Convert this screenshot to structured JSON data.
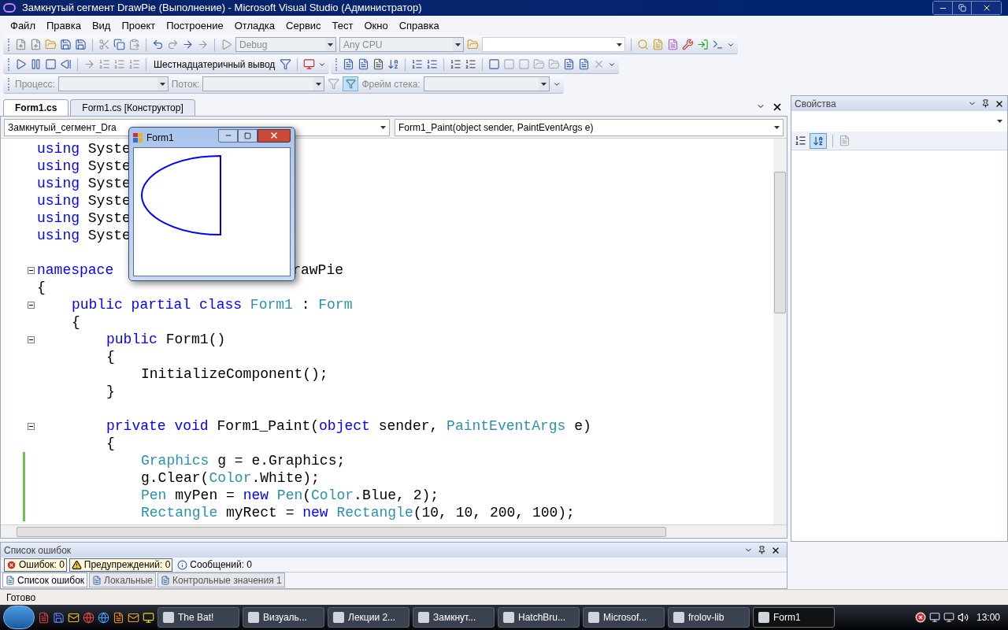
{
  "window": {
    "title": "Замкнутый сегмент DrawPie (Выполнение) - Microsoft Visual Studio (Администратор)"
  },
  "menu": [
    "Файл",
    "Правка",
    "Вид",
    "Проект",
    "Построение",
    "Отладка",
    "Сервис",
    "Тест",
    "Окно",
    "Справка"
  ],
  "toolbar": {
    "configuration": "Debug",
    "platform": "Any CPU",
    "hex_button": "Шестнадцатеричный вывод",
    "process_label": "Процесс:",
    "thread_label": "Поток:",
    "stack_frame_label": "Фрейм стека:"
  },
  "doc_tabs": [
    {
      "label": "Form1.cs",
      "selected": true
    },
    {
      "label": "Form1.cs [Конструктор]",
      "selected": false
    }
  ],
  "editor": {
    "type_dropdown": "Замкнутый_сегмент_Dra",
    "member_dropdown": "Form1_Paint(object sender, PaintEventArgs e)",
    "lines": [
      {
        "fold": false,
        "changed": false,
        "tokens": [
          {
            "text": "using ",
            "kind": "kw"
          },
          {
            "text": "Syste",
            "kind": "plain"
          }
        ]
      },
      {
        "fold": false,
        "changed": false,
        "tokens": [
          {
            "text": "using ",
            "kind": "kw"
          },
          {
            "text": "Syste",
            "kind": "plain"
          }
        ]
      },
      {
        "fold": false,
        "changed": false,
        "tokens": [
          {
            "text": "using ",
            "kind": "kw"
          },
          {
            "text": "Syste",
            "kind": "plain"
          }
        ]
      },
      {
        "fold": false,
        "changed": false,
        "tokens": [
          {
            "text": "using ",
            "kind": "kw"
          },
          {
            "text": "Syste",
            "kind": "plain"
          }
        ]
      },
      {
        "fold": false,
        "changed": false,
        "tokens": [
          {
            "text": "using ",
            "kind": "kw"
          },
          {
            "text": "Syste",
            "kind": "plain"
          }
        ]
      },
      {
        "fold": false,
        "changed": false,
        "tokens": [
          {
            "text": "using ",
            "kind": "kw"
          },
          {
            "text": "Syste",
            "kind": "plain"
          }
        ]
      },
      {
        "fold": false,
        "changed": false
      },
      {
        "fold": true,
        "changed": false,
        "tokens": [
          {
            "text": "namespace",
            "kind": "kw"
          },
          {
            "text": "rawPie",
            "kind": "plain",
            "after_gap": true
          }
        ]
      },
      {
        "fold": false,
        "changed": false,
        "tokens": [
          {
            "text": "{",
            "kind": "plain"
          }
        ],
        "children": [
          {
            "fold": true,
            "changed": false,
            "tokens": [
              {
                "text": "public partial class ",
                "kind": "kw"
              },
              {
                "text": "Form1",
                "kind": "type"
              },
              {
                "text": " : ",
                "kind": "plain"
              },
              {
                "text": "Form",
                "kind": "type"
              }
            ]
          },
          {
            "fold": false,
            "changed": false,
            "tokens": [
              {
                "text": "{",
                "kind": "plain"
              }
            ],
            "children": [
              {
                "fold": true,
                "changed": false,
                "tokens": [
                  {
                    "text": "public ",
                    "kind": "kw"
                  },
                  {
                    "text": "Form1()",
                    "kind": "plain"
                  }
                ]
              },
              {
                "fold": false,
                "changed": false,
                "tokens": [
                  {
                    "text": "{",
                    "kind": "plain"
                  }
                ],
                "children": [
                  {
                    "fold": false,
                    "changed": false,
                    "tokens": [
                      {
                        "text": "InitializeComponent();",
                        "kind": "plain"
                      }
                    ]
                  }
                ]
              },
              {
                "fold": false,
                "changed": false,
                "tokens": [
                  {
                    "text": "}",
                    "kind": "plain"
                  }
                ]
              },
              {
                "fold": false,
                "changed": false
              },
              {
                "fold": true,
                "changed": false,
                "tokens": [
                  {
                    "text": "private void ",
                    "kind": "kw"
                  },
                  {
                    "text": "Form1_Paint(",
                    "kind": "plain"
                  },
                  {
                    "text": "object ",
                    "kind": "kw"
                  },
                  {
                    "text": "sender, ",
                    "kind": "plain"
                  },
                  {
                    "text": "PaintEventArgs",
                    "kind": "type"
                  },
                  {
                    "text": " e)",
                    "kind": "plain"
                  }
                ]
              },
              {
                "fold": false,
                "changed": false,
                "tokens": [
                  {
                    "text": "{",
                    "kind": "plain"
                  }
                ],
                "children": [
                  {
                    "fold": false,
                    "changed": true,
                    "tokens": [
                      {
                        "text": "Graphics",
                        "kind": "type"
                      },
                      {
                        "text": " g = e.Graphics;",
                        "kind": "plain"
                      }
                    ]
                  },
                  {
                    "fold": false,
                    "changed": true,
                    "tokens": [
                      {
                        "text": "g.Clear(",
                        "kind": "plain"
                      },
                      {
                        "text": "Color",
                        "kind": "type"
                      },
                      {
                        "text": ".White);",
                        "kind": "plain"
                      }
                    ]
                  },
                  {
                    "fold": false,
                    "changed": true,
                    "tokens": [
                      {
                        "text": "Pen",
                        "kind": "type"
                      },
                      {
                        "text": " myPen = ",
                        "kind": "plain"
                      },
                      {
                        "text": "new ",
                        "kind": "kw"
                      },
                      {
                        "text": "Pen",
                        "kind": "type"
                      },
                      {
                        "text": "(",
                        "kind": "plain"
                      },
                      {
                        "text": "Color",
                        "kind": "type"
                      },
                      {
                        "text": ".Blue, 2);",
                        "kind": "plain"
                      }
                    ]
                  },
                  {
                    "fold": false,
                    "changed": true,
                    "tokens": [
                      {
                        "text": "Rectangle",
                        "kind": "type"
                      },
                      {
                        "text": " myRect = ",
                        "kind": "plain"
                      },
                      {
                        "text": "new ",
                        "kind": "kw"
                      },
                      {
                        "text": "Rectangle",
                        "kind": "type"
                      },
                      {
                        "text": "(10, 10, 200, 100);",
                        "kind": "plain"
                      }
                    ]
                  }
                ]
              }
            ]
          }
        ]
      }
    ]
  },
  "form_window": {
    "title": "Form1"
  },
  "properties": {
    "title": "Свойства"
  },
  "error_list": {
    "title": "Список ошибок",
    "filters": [
      {
        "kind": "error",
        "label": "Ошибок: 0",
        "selected": true
      },
      {
        "kind": "warning",
        "label": "Предупреждений: 0",
        "selected": true
      },
      {
        "kind": "info",
        "label": "Сообщений: 0",
        "selected": false
      }
    ]
  },
  "bottom_tabs": [
    {
      "label": "Список ошибок",
      "selected": true
    },
    {
      "label": "Локальные",
      "selected": false
    },
    {
      "label": "Контрольные значения 1",
      "selected": false
    }
  ],
  "status_bar": "Готово",
  "taskbar": {
    "tasks": [
      {
        "label": "The Bat!",
        "selected": false
      },
      {
        "label": "Визуаль...",
        "selected": false
      },
      {
        "label": "Лекции 2...",
        "selected": false
      },
      {
        "label": "Замкнут...",
        "selected": false
      },
      {
        "label": "HatchBru...",
        "selected": false
      },
      {
        "label": "Microsof...",
        "selected": false
      },
      {
        "label": "frolov-lib",
        "selected": false
      },
      {
        "label": "Form1",
        "selected": true
      }
    ],
    "clock": "13:00"
  }
}
